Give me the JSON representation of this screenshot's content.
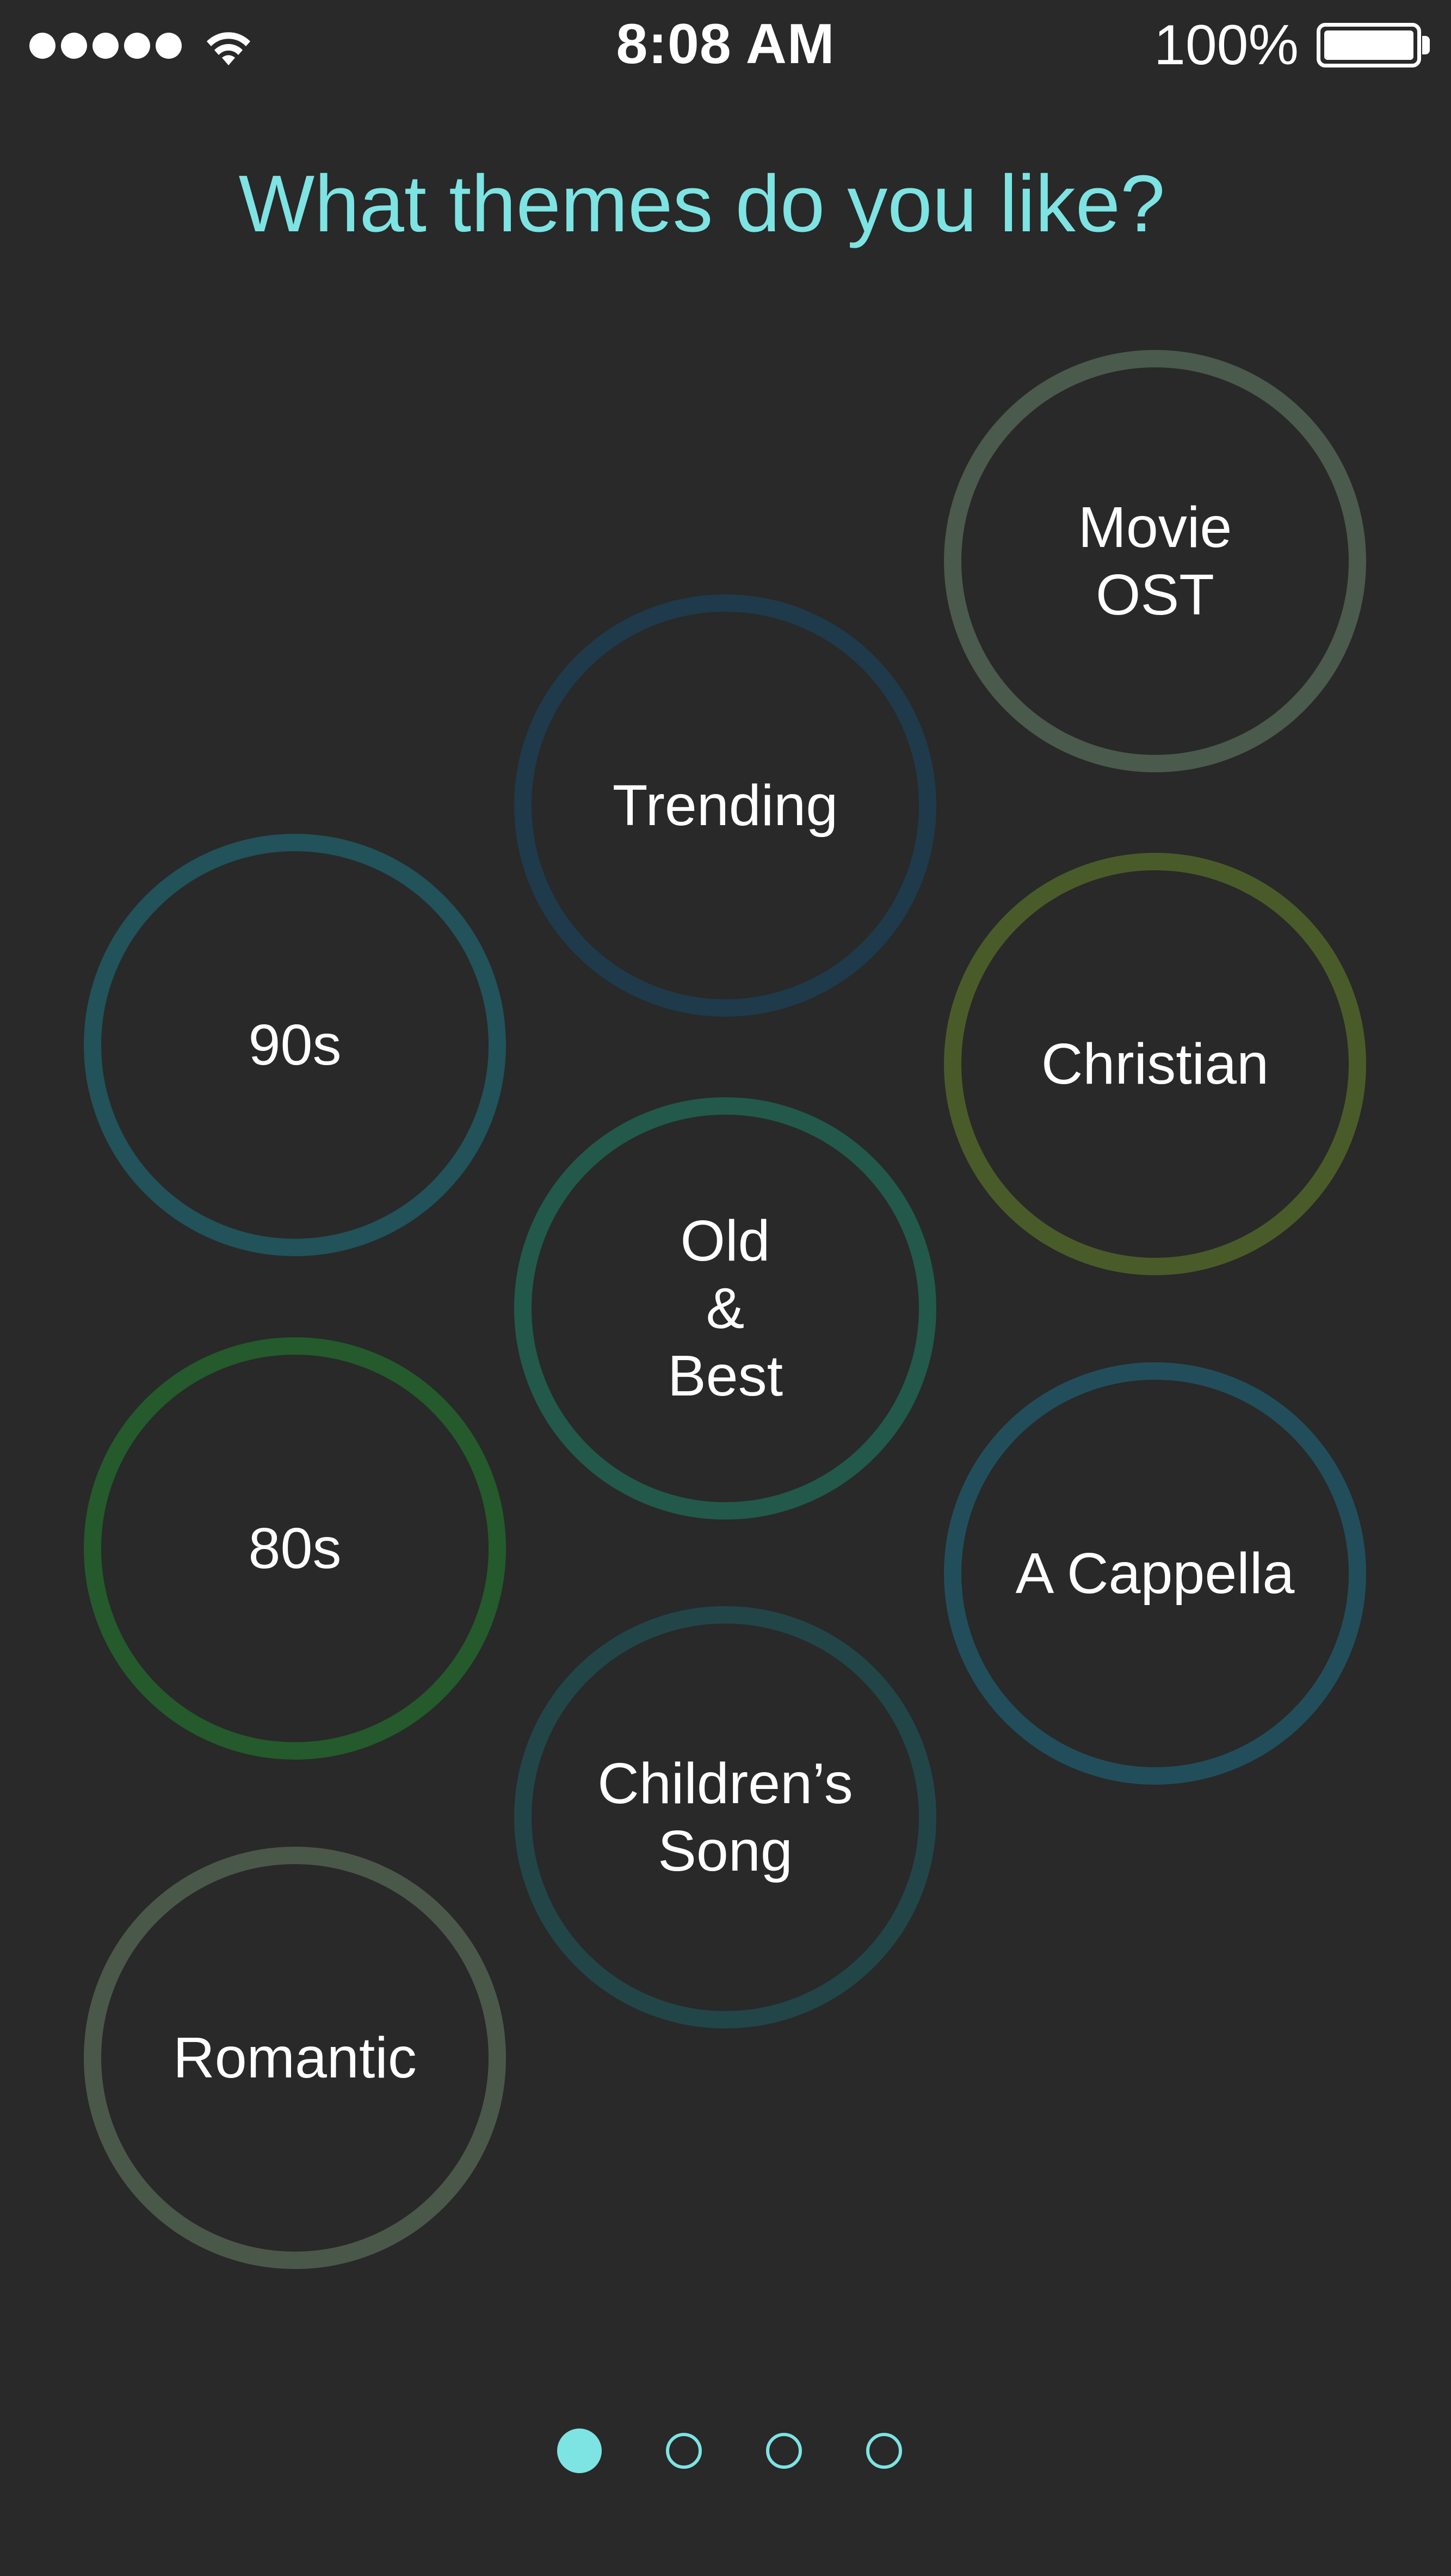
{
  "status_bar": {
    "time": "8:08 AM",
    "battery_percent": "100%",
    "battery_level": 1.0,
    "signal_bars": 5
  },
  "title": "What themes do you like?",
  "themes": [
    {
      "label": "Movie\nOST",
      "ring_color": "#4a5a4c"
    },
    {
      "label": "Trending",
      "ring_color": "#1f3a4a"
    },
    {
      "label": "90s",
      "ring_color": "#22525a"
    },
    {
      "label": "Christian",
      "ring_color": "#4a5b2a"
    },
    {
      "label": "Old\n&\nBest",
      "ring_color": "#22594a"
    },
    {
      "label": "80s",
      "ring_color": "#245a2c"
    },
    {
      "label": "A Cappella",
      "ring_color": "#224e5c"
    },
    {
      "label": "Children’s\nSong",
      "ring_color": "#224548"
    },
    {
      "label": "Romantic",
      "ring_color": "#4a584a"
    }
  ],
  "pager": {
    "total": 4,
    "current": 1,
    "color": "#7ee3e3"
  },
  "colors": {
    "background": "#282928",
    "accent": "#7ee3e3"
  },
  "icons": {
    "wifi": "wifi-icon",
    "battery": "battery-icon"
  }
}
